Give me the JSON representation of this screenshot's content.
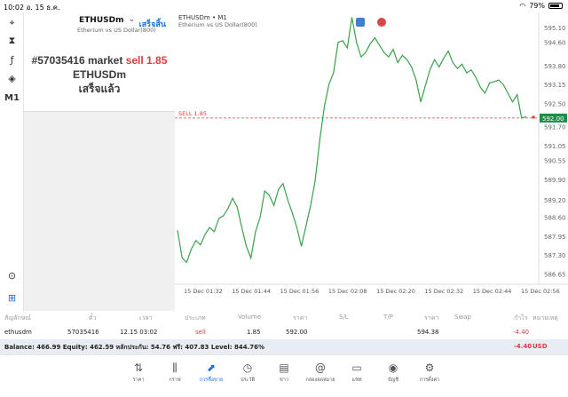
{
  "statusbar": {
    "time": "10:02",
    "date": "อ. 15 ธ.ค.",
    "battery": "79%"
  },
  "left_toolbar": {
    "items": [
      {
        "name": "crosshair-icon",
        "glyph": "⌖"
      },
      {
        "name": "candles-icon",
        "glyph": "⧗"
      },
      {
        "name": "indicators-icon",
        "glyph": "ƒ"
      },
      {
        "name": "objects-icon",
        "glyph": "◈"
      },
      {
        "name": "timeframe",
        "glyph": "M1"
      }
    ],
    "bottom_items": [
      {
        "name": "chart-settings-icon",
        "glyph": "⊙"
      },
      {
        "name": "add-icon",
        "glyph": "⊞"
      }
    ]
  },
  "order_panel": {
    "symbol": "ETHUSDm",
    "chevron": "⌄",
    "description": "Etherium vs US Dollar(800)",
    "done_label": "เสร็จสิ้น",
    "result_prefix": "#57035416 market",
    "result_sell": "sell 1.85",
    "result_symbol": "ETHUSDm",
    "result_status": "เสร็จแล้ว"
  },
  "chart": {
    "symbol_tf": "ETHUSDm • M1",
    "description": "Etherium vs US Dollar(800)",
    "sell_label": "SELL 1.85",
    "current_price": "592.00"
  },
  "chart_data": {
    "type": "line",
    "x_labels": [
      "15 Dec 01:32",
      "15 Dec 01:44",
      "15 Dec 01:56",
      "15 Dec 02:08",
      "15 Dec 02:20",
      "15 Dec 02:32",
      "15 Dec 02:44",
      "15 Dec 02:56"
    ],
    "y_ticks": [
      "595.10",
      "594.60",
      "593.80",
      "593.15",
      "592.50",
      "591.70",
      "591.05",
      "590.55",
      "589.90",
      "589.20",
      "588.60",
      "587.95",
      "587.30",
      "586.65"
    ],
    "ylim": [
      586.3,
      595.5
    ],
    "sell_price": 592.0,
    "values": [
      588.15,
      587.2,
      587.05,
      587.5,
      587.8,
      587.65,
      588.0,
      588.25,
      588.1,
      588.55,
      588.65,
      588.9,
      589.25,
      588.95,
      588.25,
      587.6,
      587.2,
      588.1,
      588.6,
      589.5,
      589.35,
      589.0,
      589.55,
      589.75,
      589.2,
      588.75,
      588.25,
      587.6,
      588.3,
      589.0,
      589.85,
      591.25,
      592.4,
      593.15,
      593.55,
      594.6,
      594.65,
      594.4,
      595.45,
      594.6,
      594.1,
      594.25,
      594.55,
      594.75,
      594.5,
      594.25,
      594.1,
      594.35,
      593.9,
      594.15,
      594.0,
      593.75,
      593.3,
      592.55,
      593.1,
      593.65,
      594.0,
      593.75,
      594.05,
      594.3,
      593.9,
      593.7,
      593.85,
      593.55,
      593.65,
      593.4,
      593.05,
      592.85,
      593.2,
      593.25,
      593.3,
      593.15,
      592.85,
      592.55,
      592.8,
      592.0,
      592.05
    ]
  },
  "table": {
    "headers": [
      "สัญลักษณ์",
      "ตั๋ว",
      "เวลา",
      "ประเภท",
      "Volume",
      "ราคา",
      "S/L",
      "T/P",
      "ราคา",
      "Swap",
      "กำไร",
      "หมายเหตุ"
    ],
    "row": [
      "ethusdm",
      "57035416",
      "12.15 03:02",
      "sell",
      "1.85",
      "592.00",
      "",
      "",
      "594.38",
      "",
      "-4.40",
      ""
    ]
  },
  "balance": {
    "text": "Balance: 466.99 Equity: 462.59 หลักประกัน: 54.76 ฟรี: 407.83 Level: 844.76%",
    "profit": "-4.40",
    "currency": "USD"
  },
  "bottom_nav": [
    {
      "name": "nav-quotes",
      "icon": "⇅",
      "label": "ราคา"
    },
    {
      "name": "nav-chart",
      "icon": "⫼",
      "label": "กราฟ"
    },
    {
      "name": "nav-trade",
      "icon": "⬈",
      "label": "การซื้อขาย"
    },
    {
      "name": "nav-history",
      "icon": "◷",
      "label": "ประวัติ"
    },
    {
      "name": "nav-news",
      "icon": "▤",
      "label": "ข่าว"
    },
    {
      "name": "nav-mailbox",
      "icon": "@",
      "label": "กล่องจดหมาย"
    },
    {
      "name": "nav-chat",
      "icon": "▭",
      "label": "แชท"
    },
    {
      "name": "nav-accounts",
      "icon": "◉",
      "label": "บัญชี"
    },
    {
      "name": "nav-settings",
      "icon": "⚙",
      "label": "การตั้งค่า"
    }
  ],
  "colors": {
    "line": "#3aa04a",
    "sell": "#e23a3a",
    "accent": "#1e6fd9",
    "price_badge": "#1f8c4a"
  }
}
